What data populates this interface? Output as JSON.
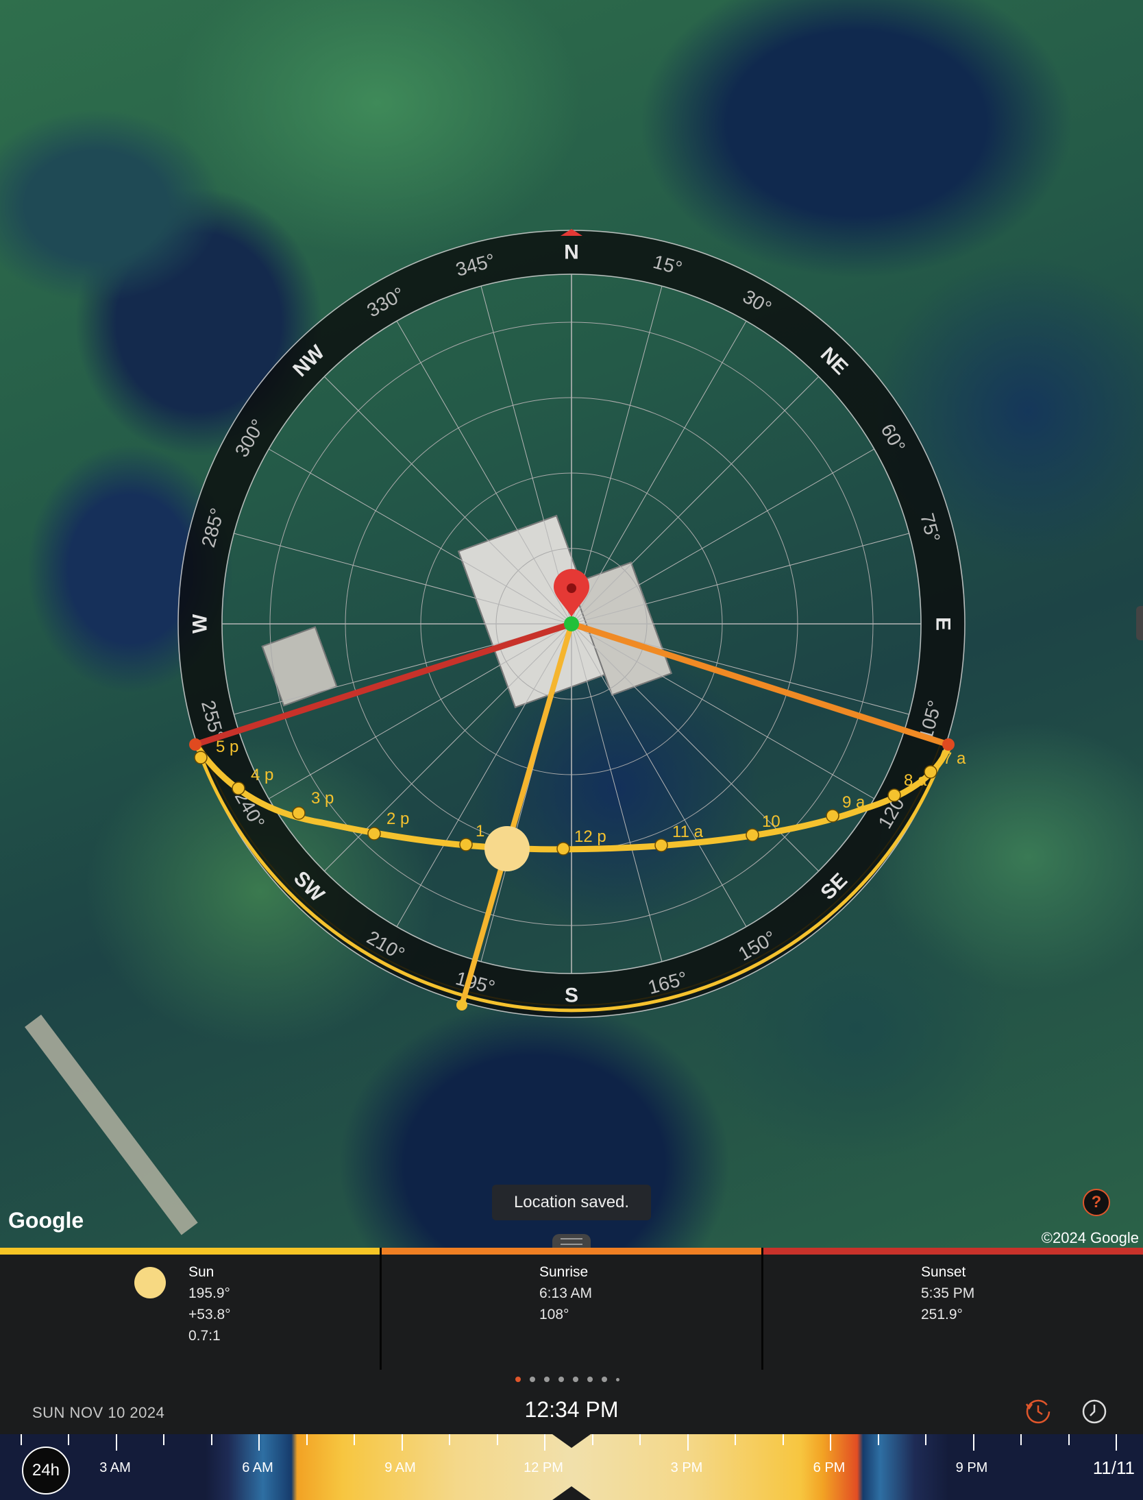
{
  "map": {
    "google_logo": "Google",
    "copyright": "©2024 Google",
    "toast": "Location saved.",
    "help_label": "?"
  },
  "compass": {
    "cardinals": [
      "N",
      "NE",
      "E",
      "SE",
      "S",
      "SW",
      "W",
      "NW"
    ],
    "degree_labels": [
      "15°",
      "30°",
      "60°",
      "75°",
      "105°",
      "120°",
      "150°",
      "165°",
      "195°",
      "210°",
      "240°",
      "255°",
      "285°",
      "300°",
      "330°",
      "345°"
    ],
    "hour_labels": [
      "5 p",
      "4 p",
      "3 p",
      "2 p",
      "1",
      "12 p",
      "11 a",
      "10",
      "9 a",
      "8 a",
      "7 a"
    ],
    "colors": {
      "sun_path": "#f5c22e",
      "sunrise_line": "#f08a24",
      "sunset_line": "#c8322a",
      "current_line": "#f5b52e",
      "north": "#e53935"
    }
  },
  "panel": {
    "sun": {
      "title": "Sun",
      "azimuth": "195.9°",
      "elevation": "+53.8°",
      "shadow_ratio": "0.7:1",
      "color": "#f6c525"
    },
    "sunrise": {
      "title": "Sunrise",
      "time": "6:13 AM",
      "azimuth": "108°",
      "color": "#ef7f23"
    },
    "sunset": {
      "title": "Sunset",
      "time": "5:35 PM",
      "azimuth": "251.9°",
      "color": "#c8322a"
    }
  },
  "footer": {
    "date": "SUN NOV 10 2024",
    "time": "12:34 PM",
    "page_dots": 8,
    "active_dot": 0
  },
  "timeline": {
    "mode_button": "24h",
    "labels": [
      "3 AM",
      "6 AM",
      "9 AM",
      "12 PM",
      "3 PM",
      "6 PM",
      "9 PM"
    ],
    "end_date": "11/11"
  }
}
